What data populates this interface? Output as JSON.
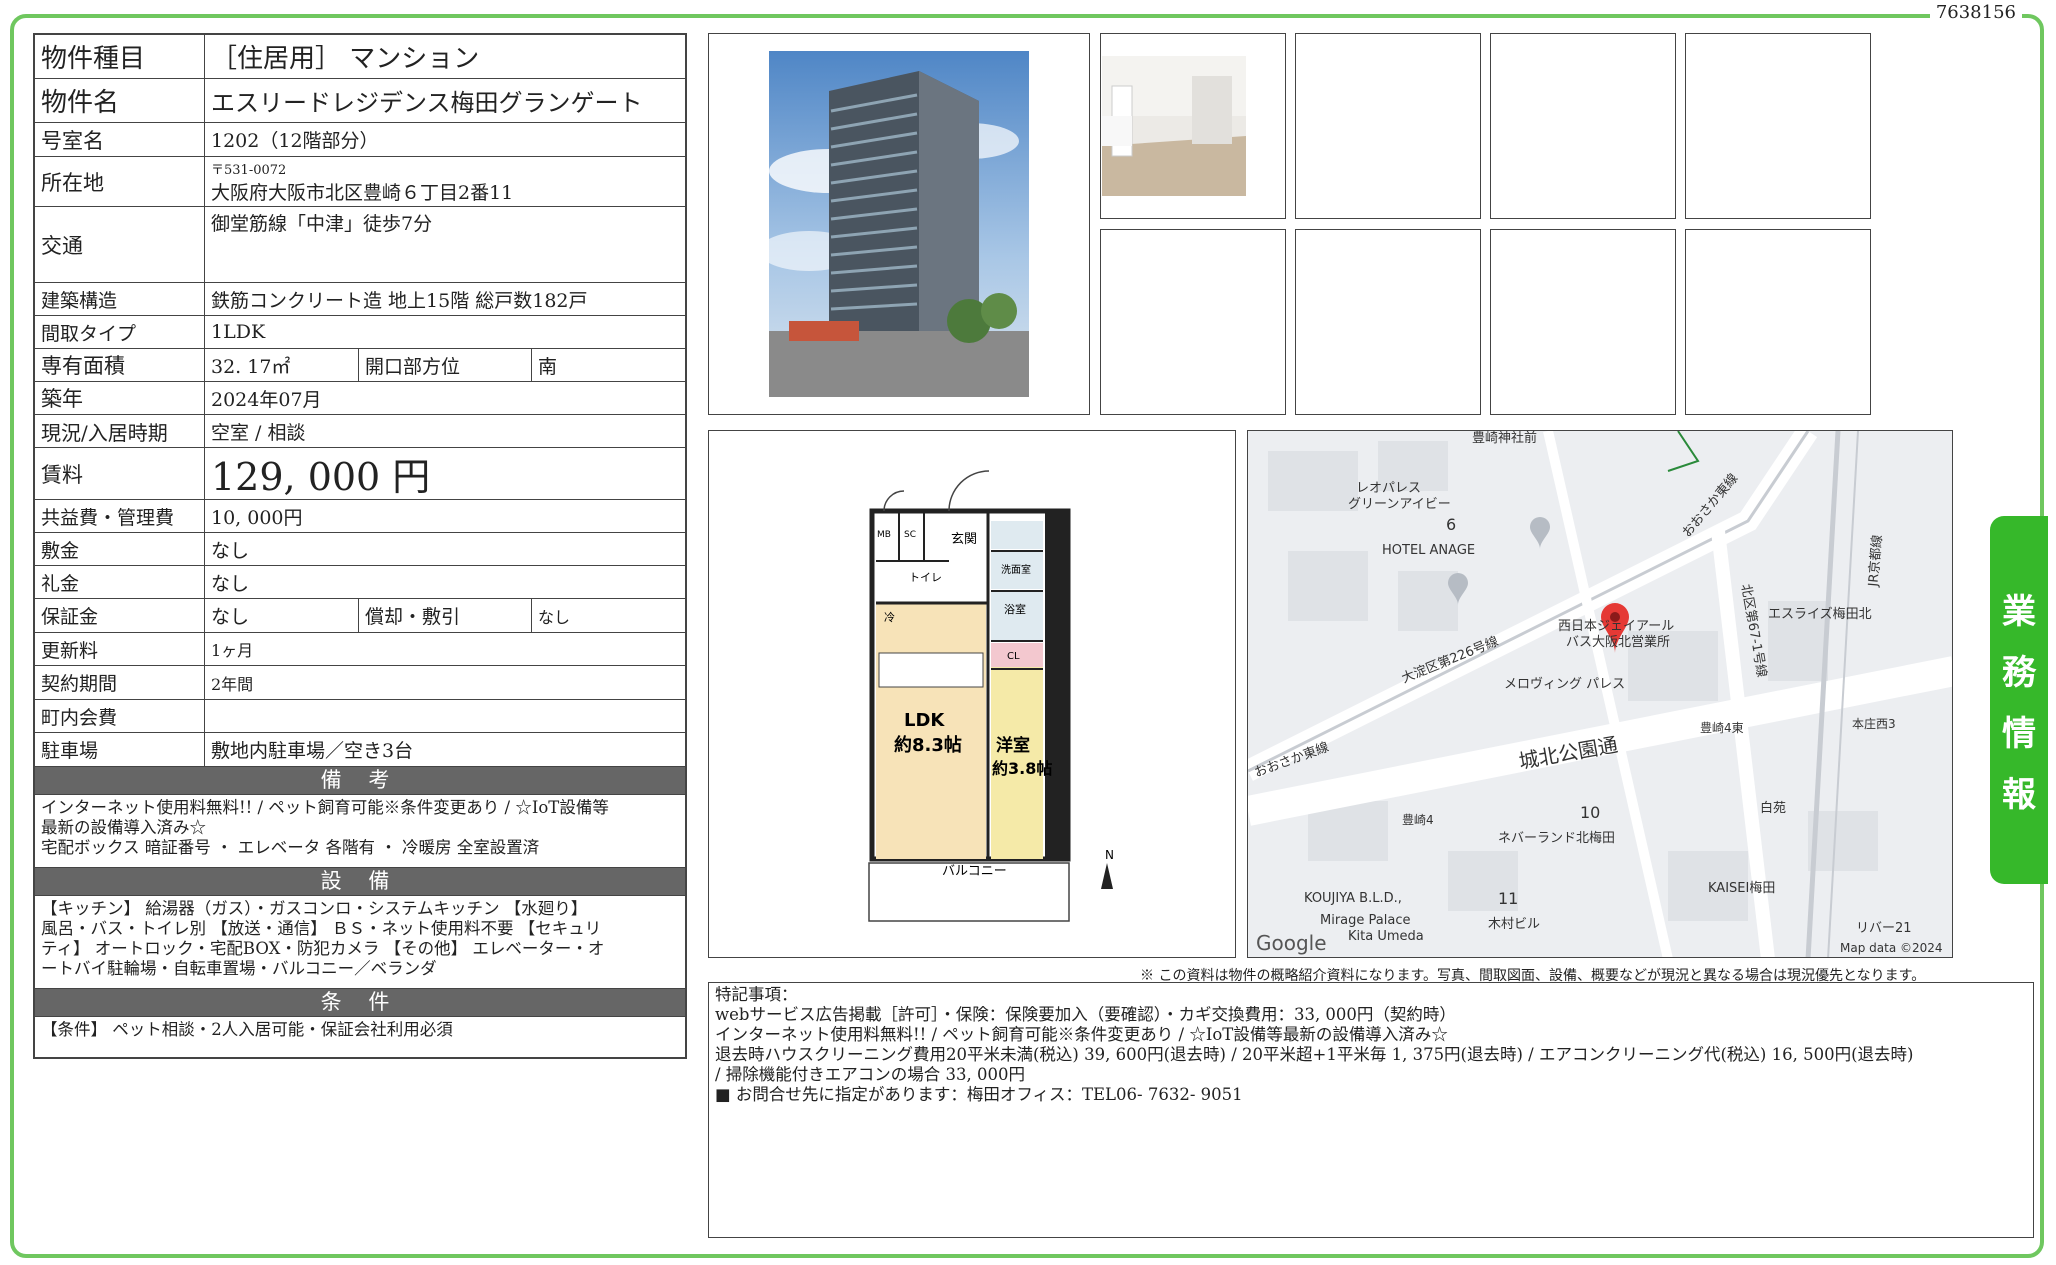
{
  "doc_id": "7638156",
  "side_tab": [
    "業",
    "務",
    "情",
    "報"
  ],
  "property": {
    "type_label": "物件種目",
    "type_value": "［住居用］ マンション",
    "name_label": "物件名",
    "name_value": "エスリードレジデンス梅田グランゲート",
    "room_label": "号室名",
    "room_value": "1202（12階部分）",
    "address_label": "所在地",
    "postal": "〒531-0072",
    "address_value": "大阪府大阪市北区豊崎６丁目2番11",
    "access_label": "交通",
    "access_value": "御堂筋線「中津」徒歩7分",
    "structure_label": "建築構造",
    "structure_value": "鉄筋コンクリート造 地上15階 総戸数182戸",
    "layout_label": "間取タイプ",
    "layout_value": "1LDK",
    "area_label": "専有面積",
    "area_value": "32. 17㎡",
    "direction_label": "開口部方位",
    "direction_value": "南",
    "built_label": "築年",
    "built_value": "2024年07月",
    "status_label": "現況/入居時期",
    "status_value": "空室 / 相談",
    "rent_label": "賃料",
    "rent_value": "129, 000 円",
    "fee_label": "共益費・管理費",
    "fee_value": "10, 000円",
    "deposit_label": "敷金",
    "deposit_value": "なし",
    "key_money_label": "礼金",
    "key_money_value": "なし",
    "guarantee_label": "保証金",
    "guarantee_value": "なし",
    "amort_label": "償却・敷引",
    "amort_value": "なし",
    "renewal_label": "更新料",
    "renewal_value": "1ヶ月",
    "contract_label": "契約期間",
    "contract_value": "2年間",
    "association_label": "町内会費",
    "association_value": "",
    "parking_label": "駐車場",
    "parking_value": "敷地内駐車場／空き3台"
  },
  "remarks_section": {
    "title": "備 考",
    "lines": [
      "インターネット使用料無料!! / ペット飼育可能※条件変更あり / ☆IoT設備等",
      "最新の設備導入済み☆",
      "宅配ボックス 暗証番号 ・ エレベータ 各階有 ・ 冷暖房 全室設置済"
    ]
  },
  "equipment_section": {
    "title": "設 備",
    "lines": [
      "【キッチン】 給湯器（ガス）・ガスコンロ・システムキッチン 【水廻り】",
      "風呂・バス・トイレ別 【放送・通信】 ＢＳ・ネット使用料不要 【セキュリ",
      "ティ】 オートロック・宅配BOX・防犯カメラ 【その他】 エレベーター・オ",
      "ートバイ駐輪場・自転車置場・バルコニー／ベランダ"
    ]
  },
  "conditions_section": {
    "title": "条 件",
    "lines": [
      "【条件】 ペット相談・2人入居可能・保証会社利用必須"
    ]
  },
  "floorplan": {
    "ldk": "LDK",
    "ldk_size": "約8.3帖",
    "western": "洋室",
    "western_size": "約3.8帖",
    "balcony": "バルコニー",
    "entrance": "玄関",
    "toilet": "トイレ",
    "bath": "浴室",
    "wash": "洗面室",
    "mb": "MB",
    "sc": "SC",
    "cl": "CL",
    "fridge": "冷",
    "north": "N"
  },
  "map": {
    "labels": {
      "leopalace": "レオパレス",
      "green_ivy": "グリーンアイビー",
      "six": "6",
      "hotel_anage": "HOTEL ANAGE",
      "osaka_higashi": "おおさか東線",
      "kita_67": "北区第67-1号線",
      "jr_kyoto": "JR京都線",
      "yodogawa_226": "大淀区第226号線",
      "nishinihon_jr": "西日本ジェイアール",
      "bus_office": "バス大阪北営業所",
      "esrise": "エスライズ梅田北",
      "melo": "メロヴィング パレス",
      "osaka_higashi2": "おおさか東線",
      "toyosaki4higashi": "豊崎4東",
      "honjonishi3": "本庄西3",
      "jokuhoku": "城北公園通",
      "hakuen": "白苑",
      "ten": "10",
      "toyosaki4": "豊崎4",
      "neverland": "ネバーランド北梅田",
      "kaisei": "KAISEI梅田",
      "koujiya": "KOUJIYA B.L.D.,",
      "eleven": "11",
      "mirage": "Mirage Palace",
      "kita_umeda": "Kita Umeda",
      "kimura": "木村ビル",
      "river21": "リバー21",
      "google": "Google",
      "mapdata": "Map data ©2024",
      "toyosaki_top": "豊崎神社前"
    }
  },
  "disclaimer": "※ この資料は物件の概略紹介資料になります。写真、間取図面、設備、概要などが現況と異なる場合は現況優先となります。",
  "special_notes": {
    "lines": [
      "特記事項：",
      "webサービス広告掲載［許可］・保険：保険要加入（要確認）・カギ交換費用：33, 000円（契約時）",
      "インターネット使用料無料!! / ペット飼育可能※条件変更あり / ☆IoT設備等最新の設備導入済み☆",
      "退去時ハウスクリーニング費用20平米未満(税込) 39, 600円(退去時) / 20平米超+1平米毎 1, 375円(退去時) / エアコンクリーニング代(税込) 16, 500円(退去時)",
      "/ 掃除機能付きエアコンの場合 33, 000円",
      "■ お問合せ先に指定があります：梅田オフィス：TEL06- 7632- 9051"
    ]
  },
  "colors": {
    "frame_green": "#6fc75f",
    "tab_green": "#36b82a",
    "section_gray": "#666666"
  }
}
